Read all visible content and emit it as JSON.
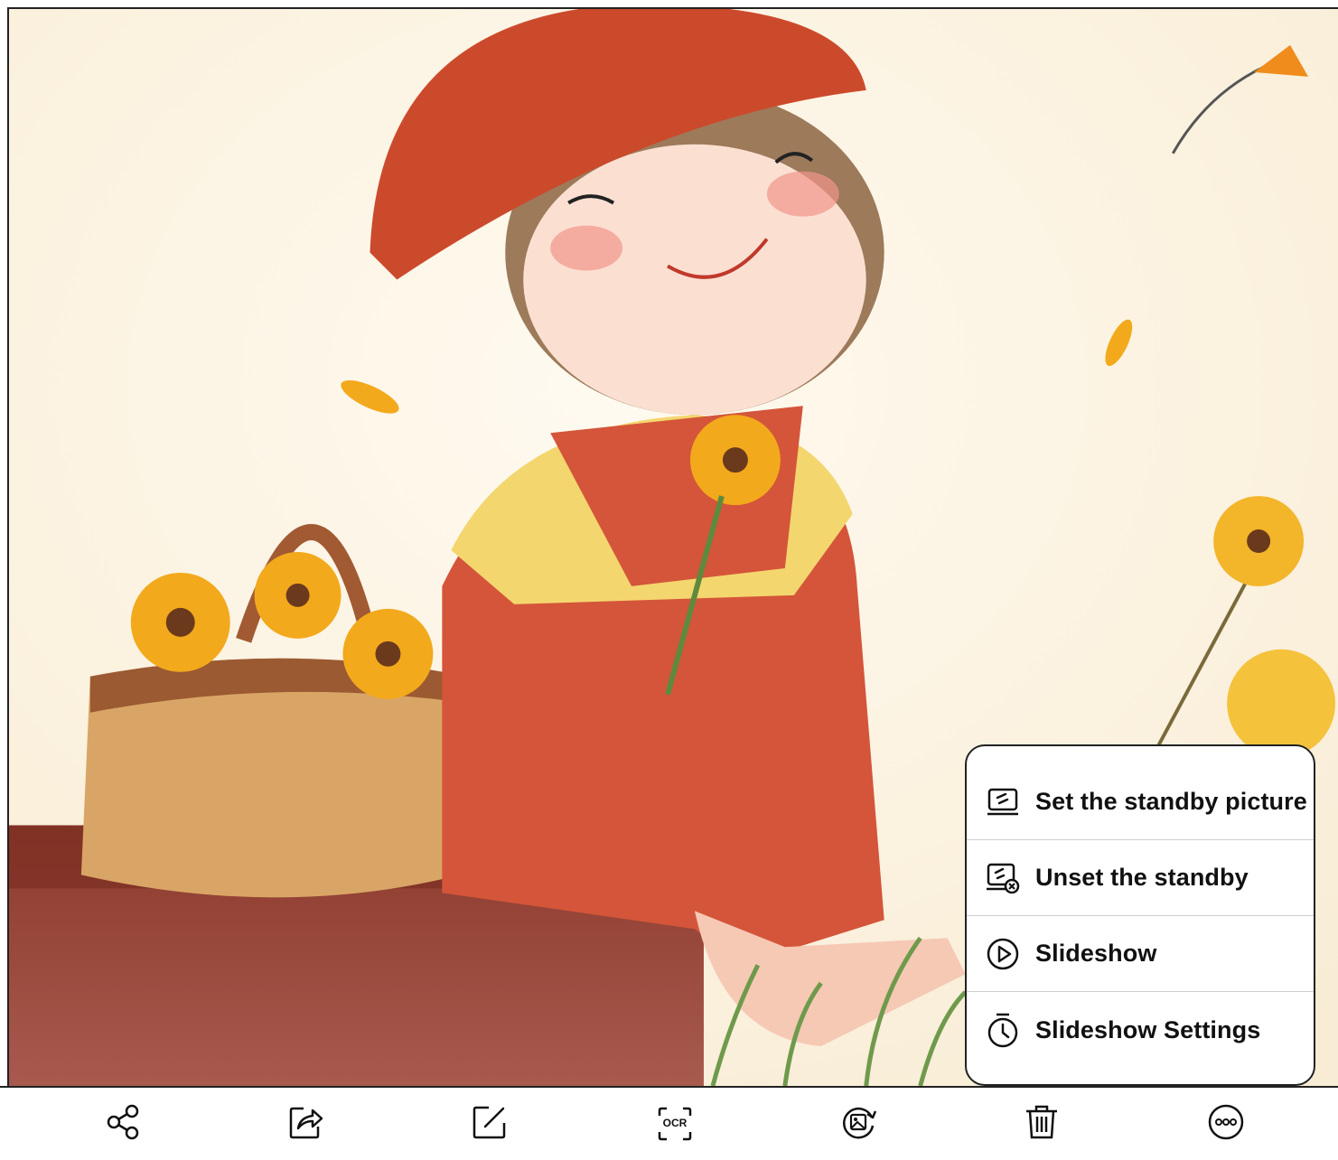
{
  "menu": {
    "items": [
      {
        "label": "Set the standby picture",
        "icon": "standby-picture-icon"
      },
      {
        "label": "Unset the standby",
        "icon": "unset-standby-icon"
      },
      {
        "label": "Slideshow",
        "icon": "play-icon"
      },
      {
        "label": "Slideshow Settings",
        "icon": "timer-icon"
      }
    ]
  },
  "toolbar": {
    "items": [
      {
        "name": "share",
        "icon": "share-icon"
      },
      {
        "name": "forward",
        "icon": "forward-icon"
      },
      {
        "name": "edit",
        "icon": "edit-icon"
      },
      {
        "name": "ocr",
        "icon": "ocr-icon",
        "label": "OCR"
      },
      {
        "name": "rotate-image",
        "icon": "rotate-image-icon"
      },
      {
        "name": "delete",
        "icon": "trash-icon"
      },
      {
        "name": "more",
        "icon": "more-icon"
      }
    ]
  }
}
